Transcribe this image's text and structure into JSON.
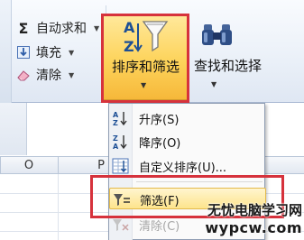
{
  "ribbon": {
    "autosum": {
      "label": "自动求和",
      "icon": "sigma-icon"
    },
    "fill": {
      "label": "填充",
      "icon": "fill-down-icon"
    },
    "clear": {
      "label": "清除",
      "icon": "eraser-icon"
    },
    "sort_filter": {
      "label": "排序和筛选",
      "icon": "sort-filter-icon",
      "highlighted": true
    },
    "find_select": {
      "label": "查找和选择",
      "icon": "binoculars-icon"
    }
  },
  "sheet": {
    "column_headers": [
      "O",
      "P"
    ]
  },
  "menu": {
    "items": [
      {
        "label": "升序(S)",
        "icon": "sort-ascending-icon",
        "state": "normal"
      },
      {
        "label": "降序(O)",
        "icon": "sort-descending-icon",
        "state": "normal"
      },
      {
        "label": "自定义排序(U)...",
        "icon": "custom-sort-icon",
        "state": "normal"
      },
      {
        "label": "筛选(F)",
        "icon": "filter-icon",
        "state": "hover"
      },
      {
        "label": "清除(C)",
        "icon": "clear-filter-icon",
        "state": "disabled"
      }
    ]
  },
  "watermark": {
    "line1": "无忧电脑学习网",
    "line2": "wypcw.com"
  },
  "colors": {
    "highlight_outline": "#d6323c",
    "button_active": "#fdd35a",
    "menu_hover": "#fde48c"
  }
}
